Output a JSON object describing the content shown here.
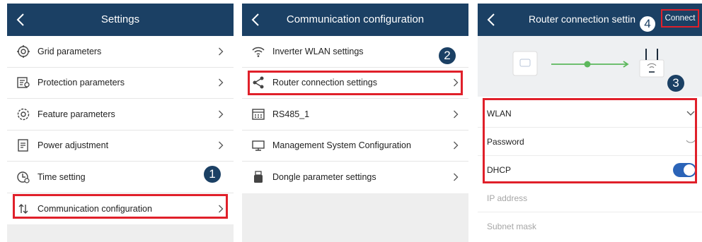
{
  "panel1": {
    "title": "Settings",
    "items": [
      {
        "label": "Grid parameters",
        "icon": "grid-gear-icon"
      },
      {
        "label": "Protection parameters",
        "icon": "protection-icon"
      },
      {
        "label": "Feature parameters",
        "icon": "feature-gear-icon"
      },
      {
        "label": "Power adjustment",
        "icon": "power-adjust-icon"
      },
      {
        "label": "Time setting",
        "icon": "clock-icon"
      },
      {
        "label": "Communication configuration",
        "icon": "transfer-arrows-icon"
      }
    ],
    "step_badge": "1"
  },
  "panel2": {
    "title": "Communication configuration",
    "items": [
      {
        "label": "Inverter WLAN settings",
        "icon": "wifi-icon"
      },
      {
        "label": "Router connection settings",
        "icon": "share-nodes-icon"
      },
      {
        "label": "RS485_1",
        "icon": "serial-grid-icon"
      },
      {
        "label": "Management System Configuration",
        "icon": "monitor-icon"
      },
      {
        "label": "Dongle parameter settings",
        "icon": "dongle-icon"
      }
    ],
    "step_badge": "2"
  },
  "panel3": {
    "title": "Router connection settin",
    "connect_label": "Connect",
    "fields": [
      {
        "label": "WLAN"
      },
      {
        "label": "Password"
      },
      {
        "label": "DHCP"
      },
      {
        "label": "IP address"
      },
      {
        "label": "Subnet mask"
      }
    ],
    "dhcp_enabled": true,
    "step_badge_3": "3",
    "step_badge_4": "4"
  },
  "colors": {
    "header": "#1b4064",
    "highlight": "#e0202a",
    "toggle_on": "#2b64b8",
    "link_line": "#5cb85c"
  }
}
